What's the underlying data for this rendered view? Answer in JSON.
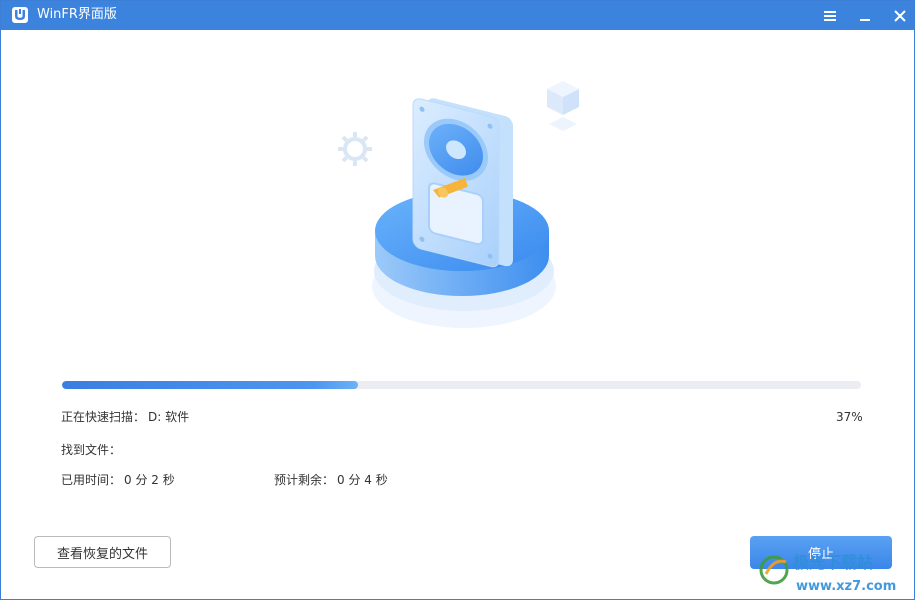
{
  "window": {
    "title": "WinFR界面版"
  },
  "icons": {
    "app": "winfr-logo-icon",
    "menu": "hamburger-menu-icon",
    "minimize": "minimize-icon",
    "close": "close-icon"
  },
  "scan": {
    "status_label": "正在快速扫描：",
    "drive": "D: 软件",
    "percent_text": "37%",
    "progress": 0.37,
    "found_label": "找到文件：",
    "elapsed_label": "已用时间：",
    "elapsed_value": "0 分 2 秒",
    "remaining_label": "预计剩余：",
    "remaining_value": "0 分 4 秒"
  },
  "buttons": {
    "view_recovered": "查看恢复的文件",
    "stop": "停止"
  },
  "watermark": {
    "text": "极光下载站",
    "url": "www.xz7.com"
  },
  "colors": {
    "accent": "#3b83dc",
    "progress": "#3a7fe0",
    "primary_button": "#4a92ee"
  }
}
